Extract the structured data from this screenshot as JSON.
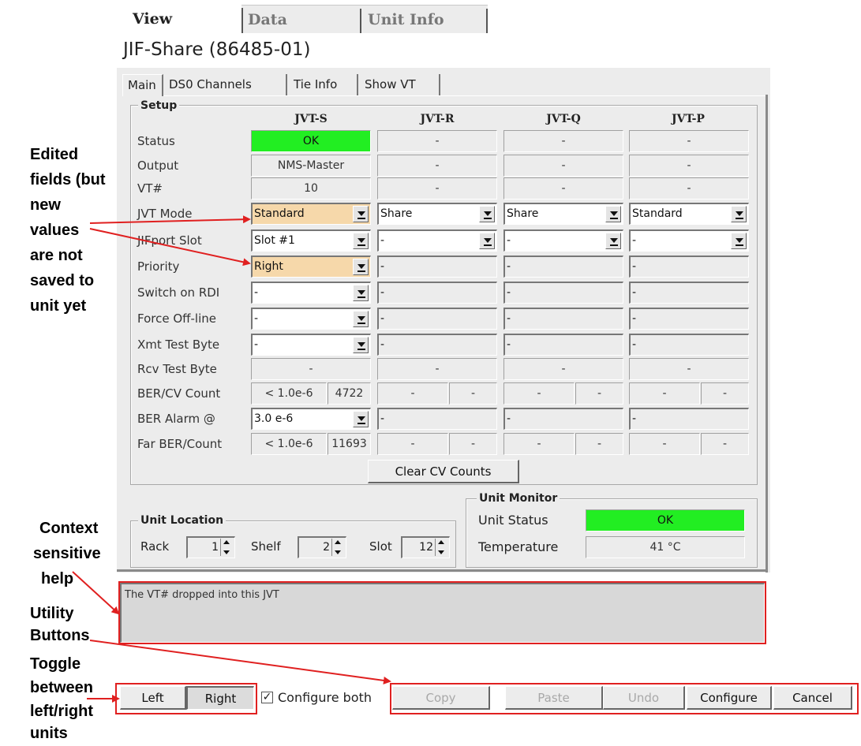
{
  "annotations": {
    "edited": [
      "Edited",
      "fields (but",
      "new",
      "values",
      "are not",
      "saved to",
      "unit yet"
    ],
    "context": [
      "Context",
      "sensitive",
      "help"
    ],
    "utility": [
      "Utility",
      "Buttons"
    ],
    "toggle": [
      "Toggle",
      "between",
      "left/right",
      "units"
    ]
  },
  "tabs": [
    "View",
    "Data",
    "Unit Info"
  ],
  "unit_title": "JIF-Share (86485-01)",
  "subtabs": [
    "Main",
    "DS0 Channels",
    "Tie Info",
    "Show VT"
  ],
  "setup": {
    "label": "Setup",
    "columns": [
      "JVT-S",
      "JVT-R",
      "JVT-Q",
      "JVT-P"
    ],
    "rows": [
      "Status",
      "Output",
      "VT#",
      "JVT Mode",
      "JIFport Slot",
      "Priority",
      "Switch on RDI",
      "Force Off-line",
      "Xmt Test Byte",
      "Rcv Test Byte",
      "BER/CV Count",
      "BER Alarm @",
      "Far BER/Count"
    ],
    "status": [
      "OK",
      "-",
      "-",
      "-"
    ],
    "output": [
      "NMS-Master",
      "-",
      "-",
      "-"
    ],
    "vt": [
      "10",
      "-",
      "-",
      "-"
    ],
    "jvt_mode": [
      "Standard",
      "Share",
      "Share",
      "Standard"
    ],
    "jifport_slot": [
      "Slot #1",
      "-",
      "-",
      "-"
    ],
    "priority": [
      "Right",
      "-",
      "-",
      "-"
    ],
    "switch_rdi": [
      "-",
      "-",
      "-",
      "-"
    ],
    "force_offline": [
      "-",
      "-",
      "-",
      "-"
    ],
    "xmt_test": [
      "-",
      "-",
      "-",
      "-"
    ],
    "rcv_test": [
      "-",
      "-",
      "-",
      "-"
    ],
    "ber_cv": [
      [
        "< 1.0e-6",
        "4722"
      ],
      [
        "-",
        "-"
      ],
      [
        "-",
        "-"
      ],
      [
        "-",
        "-"
      ]
    ],
    "ber_alarm": [
      "3.0 e-6",
      "-",
      "-",
      "-"
    ],
    "far_ber": [
      [
        "< 1.0e-6",
        "11693"
      ],
      [
        "-",
        "-"
      ],
      [
        "-",
        "-"
      ],
      [
        "-",
        "-"
      ]
    ],
    "clear_button": "Clear CV Counts"
  },
  "unit_location": {
    "label": "Unit Location",
    "rack_label": "Rack",
    "rack": "1",
    "shelf_label": "Shelf",
    "shelf": "2",
    "slot_label": "Slot",
    "slot": "12"
  },
  "unit_monitor": {
    "label": "Unit Monitor",
    "status_label": "Unit Status",
    "status": "OK",
    "temp_label": "Temperature",
    "temp": "41 °C"
  },
  "help_text": "The VT# dropped into this JVT",
  "toggle": {
    "left": "Left",
    "right": "Right"
  },
  "configure_both": {
    "checked": true,
    "label": "Configure both"
  },
  "utility_buttons": {
    "copy": "Copy",
    "paste": "Paste",
    "undo": "Undo",
    "configure": "Configure",
    "cancel": "Cancel"
  },
  "colors": {
    "ok_green": "#22ee22",
    "edited": "#f6d8aa",
    "annotation_red": "#e02020"
  }
}
